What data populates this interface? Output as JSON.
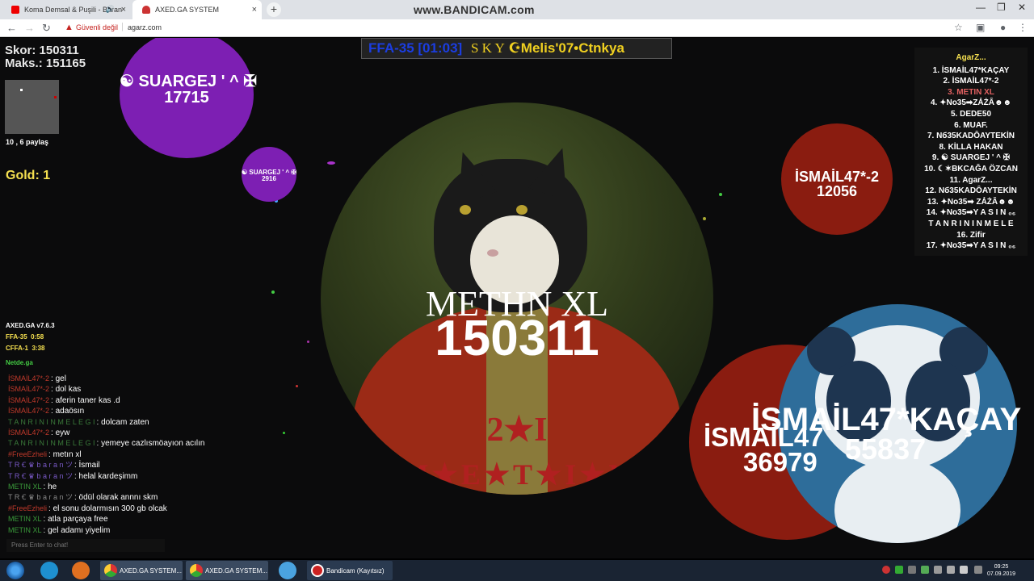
{
  "browser": {
    "tabs": [
      {
        "title": "Koma Demsal & Puşili - Baran",
        "active": false
      },
      {
        "title": "AXED.GA SYSTEM",
        "active": true
      }
    ],
    "watermark": "www.BANDICAM.com",
    "security_label": "Güvenli değil",
    "url": "agarz.com"
  },
  "hud": {
    "score": "Skor: 150311",
    "max_score": "Maks.: 151165",
    "share": "10 , 6 paylaş",
    "gold": "Gold: 1",
    "version": "AXED.GA v7.6.3",
    "servers": [
      {
        "name": "FFA-35",
        "time": "0:58"
      },
      {
        "name": "CFFA-1",
        "time": "3:38"
      }
    ],
    "site": "Netde.ga",
    "chat_placeholder": "Press Enter to chat!"
  },
  "topbar": {
    "mode": "FFA-35 [01:03]",
    "clan": "S K Y",
    "title": "☪Melis'07•Ctnkya"
  },
  "leaderboard": {
    "title": "AgarZ...",
    "entries": [
      "1. İSMAİL47*KAÇAY",
      "2. İSMAİL47*-2",
      "3. ΜΕΤΙΝ ΧL",
      "4. ✦No35➡ZẢŻÂ☻☻",
      "5. DEDE50",
      "6. MUAF.",
      "7. Nб35KADÔAYTEKİN",
      "8. KİLLA HAKAN",
      "9. ☯ SUARGEJ ' ^ ✠",
      "10. ☾✶BKCAĞA ÖZCAN",
      "11. AgarZ...",
      "12. Nб35KADÔAYTEKİN",
      "13. ✦No35➡ ZẢŻÂ☻☻",
      "14. ✦No35➡Y A S I N ₀₆",
      "T A N R I N I N M E L E",
      "16. Zifir",
      "17. ✦No35➡Y A S I N ₀₆"
    ]
  },
  "chat": [
    {
      "name": "İSMAİL47*-2",
      "name_color": "#c0392b",
      "msg": ": gel"
    },
    {
      "name": "İSMAİL47*-2",
      "name_color": "#c0392b",
      "msg": ": dol kas"
    },
    {
      "name": "İSMAİL47*-2",
      "name_color": "#c0392b",
      "msg": ": aferin taner kas .d"
    },
    {
      "name": "İSMAİL47*-2",
      "name_color": "#c0392b",
      "msg": ": adaösın"
    },
    {
      "name": "T A N R I N I N M E L E G I",
      "name_color": "#3a7a3a",
      "msg": ": dolcam zaten"
    },
    {
      "name": "İSMAİL47*-2",
      "name_color": "#c0392b",
      "msg": ": eyw"
    },
    {
      "name": "T A N R I N I N M E L E G I",
      "name_color": "#3a7a3a",
      "msg": ": yemeye cazlısmöayıon acılın"
    },
    {
      "name": "#FreeEzheli",
      "name_color": "#c0392b",
      "msg": ": metın xl"
    },
    {
      "name": "T R Ꞓ ♛ b a r a n ツ",
      "name_color": "#7a5ac8",
      "msg": ": İsmail"
    },
    {
      "name": "T R Ꞓ ♛ b a r a n ツ",
      "name_color": "#7a5ac8",
      "msg": ": helal kardeşimm"
    },
    {
      "name": "ΜΕΤΙΝ ΧL",
      "name_color": "#3a9a3a",
      "msg": ": he"
    },
    {
      "name": "T R Ꞓ ♛ b a r a n ツ",
      "name_color": "#888888",
      "msg": ": ödül olarak annnı skm"
    },
    {
      "name": "#FreeEzheli",
      "name_color": "#c0392b",
      "msg": ": el sonu dolarmısın 300 gb olcak"
    },
    {
      "name": "ΜΕΤΙΝ ΧL",
      "name_color": "#3a9a3a",
      "msg": ": atla parçaya free"
    },
    {
      "name": "ΜΕΤΙΝ ΧL",
      "name_color": "#3a9a3a",
      "msg": ": gel adamı yiyelim"
    }
  ],
  "cells": {
    "player": {
      "name": "ΜΕΤΗΝ ΧL",
      "mass": "150311",
      "skin_text": "2★I",
      "skin_arc": "M★E★T★I★N"
    },
    "suargej_big": {
      "name": "☯ SUARGEJ ' ^ ✠",
      "mass": "17715"
    },
    "suargej_small": {
      "name": "☯ SUARGEJ ' ^ ✠",
      "mass": "2916"
    },
    "ismail2": {
      "name": "İSMAİL47*-2",
      "mass": "12056"
    },
    "ismail_red": {
      "name": "İSMAİL47",
      "mass": "36979"
    },
    "ismail_panda": {
      "name": "İSMAİL47*KAÇAY",
      "mass": "55837"
    }
  },
  "taskbar": {
    "items": [
      "AXED.GA SYSTEM...",
      "AXED.GA SYSTEM...",
      "Bandicam (Kayıtsız)"
    ],
    "time": "09:25",
    "date": "07.09.2019"
  },
  "colors": {
    "purple_cell": "#7d1fb3",
    "red_cell": "#8a1c10",
    "panda_cell": "#2e6d9a",
    "gold": "#f5e050",
    "topbar_blue": "#1b3de0",
    "topbar_yellow": "#f0d020"
  }
}
